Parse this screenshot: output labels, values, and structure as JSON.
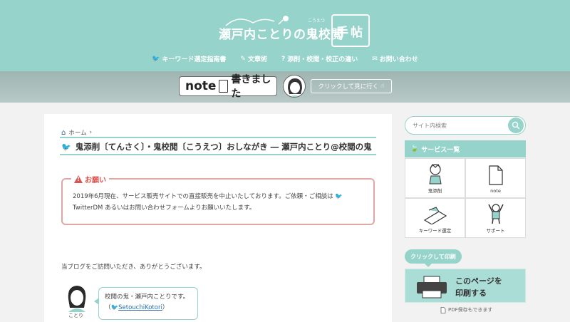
{
  "site": {
    "logo_title": "瀬戸内ことりの鬼校閲",
    "logo_ruby": "こうえつ",
    "logo_book": "手帖"
  },
  "nav": [
    {
      "icon": "bird-icon",
      "label": "キーワード選定指南書"
    },
    {
      "icon": "pencil-icon",
      "label": "文章術"
    },
    {
      "icon": "question-icon",
      "label": "添削・校閲・校正の違い"
    },
    {
      "icon": "mail-icon",
      "label": "お問い合わせ"
    }
  ],
  "banner": {
    "note_word": "note",
    "note_text": "書きました",
    "click_label": "クリックして見に行く"
  },
  "breadcrumb": {
    "home": "ホーム"
  },
  "post": {
    "title": "鬼添削〔てんさく〕・鬼校閲〔こうえつ〕おしながき ― 瀬戸内ことり@校閲の鬼"
  },
  "alert": {
    "label": "お願い",
    "line1": "2019年6月現在、サービス販売サイトでの直接販売を中止いたしております。ご依頼・ご相談は",
    "line2_link": "TwitterDM",
    "line2_rest": " あるいはお問い合わせフォームよりお願いいたします。"
  },
  "intro": "当ブログをご訪問いただき、ありがとうございます。",
  "author": {
    "name": "ことり",
    "bubble_line1": "校閲の鬼・瀬戸内ことりです。",
    "handle_open": "（",
    "handle": "SetouchiKotori",
    "handle_close": "）"
  },
  "sidebar": {
    "search_placeholder": "サイト内検索",
    "services_heading": "サービス一覧",
    "services": [
      {
        "icon": "editor-character-icon",
        "label": "鬼添削"
      },
      {
        "icon": "document-icon",
        "label": "note"
      },
      {
        "icon": "keyboard-hand-icon",
        "label": "キーワード選定"
      },
      {
        "icon": "cheering-person-icon",
        "label": "サポート"
      }
    ],
    "print_badge": "クリックして印刷",
    "print_line1": "このページを",
    "print_line2": "印刷する",
    "pdf_note": "PDF保存もできます"
  },
  "colors": {
    "accent": "#95d3cb",
    "alert": "#d9534f",
    "twitter": "#4aaee8"
  }
}
